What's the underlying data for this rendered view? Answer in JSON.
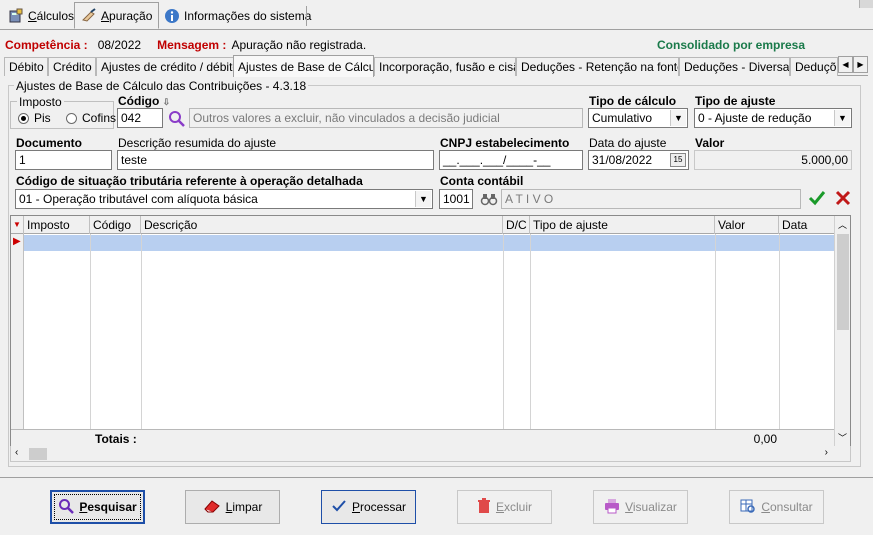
{
  "top_tabs": [
    {
      "label": "Cálculos",
      "underline": "C",
      "rest": "álculos"
    },
    {
      "label": "Apuração",
      "underline": "A",
      "rest": "puração"
    },
    {
      "label": "Informações do sistema"
    }
  ],
  "info": {
    "competencia_label": "Competência :",
    "competencia_value": "08/2022",
    "mensagem_label": "Mensagem :",
    "mensagem_value": "Apuração não registrada.",
    "consolidado": "Consolidado por empresa"
  },
  "inner_tabs": [
    "Débito",
    "Crédito",
    "Ajustes de crédito / débito",
    "Ajustes de Base de Cálculo",
    "Incorporação, fusão e cisão",
    "Deduções - Retenção na fonte",
    "Deduções - Diversas",
    "Deduçõ"
  ],
  "form": {
    "group_title": "Ajustes de Base de Cálculo das Contribuições - 4.3.18",
    "imposto_label": "Imposto",
    "pis": "Pis",
    "cofins": "Cofins",
    "codigo_label": "Código",
    "codigo_value": "042",
    "codigo_desc": "Outros valores a excluir, não vinculados a decisão judicial",
    "tipo_calculo_label": "Tipo de cálculo",
    "tipo_calculo_value": "Cumulativo",
    "tipo_ajuste_label": "Tipo de ajuste",
    "tipo_ajuste_value": "0 - Ajuste de redução",
    "documento_label": "Documento",
    "documento_value": "1",
    "descricao_label": "Descrição resumida do ajuste",
    "descricao_value": "teste",
    "cnpj_label": "CNPJ estabelecimento",
    "cnpj_value": "__.___.___/____-__",
    "data_label": "Data do ajuste",
    "data_value": "31/08/2022",
    "valor_label": "Valor",
    "valor_value": "5.000,00",
    "cst_label": "Código de situação tributária referente à operação detalhada",
    "cst_value": "01 - Operação tributável com alíquota básica",
    "conta_label": "Conta contábil",
    "conta_value": "1001",
    "conta_desc": "A T I V O"
  },
  "grid": {
    "columns": [
      "Imposto",
      "Código",
      "Descrição",
      "D/C",
      "Tipo de ajuste",
      "Valor",
      "Data"
    ],
    "totals_label": "Totais :",
    "totals_value": "0,00"
  },
  "buttons": {
    "pesquisar": {
      "u": "P",
      "rest": "esquisar"
    },
    "limpar": {
      "u": "L",
      "rest": "impar"
    },
    "processar": {
      "u": "P",
      "rest": "rocessar"
    },
    "excluir": {
      "u": "E",
      "rest": "xcluir"
    },
    "visualizar": {
      "u": "V",
      "rest": "isualizar"
    },
    "consultar": {
      "u": "C",
      "rest": "onsultar"
    }
  },
  "colors": {
    "accent_red": "#c00000",
    "accent_green": "#1a7a4a",
    "selection": "#b8cff0"
  }
}
